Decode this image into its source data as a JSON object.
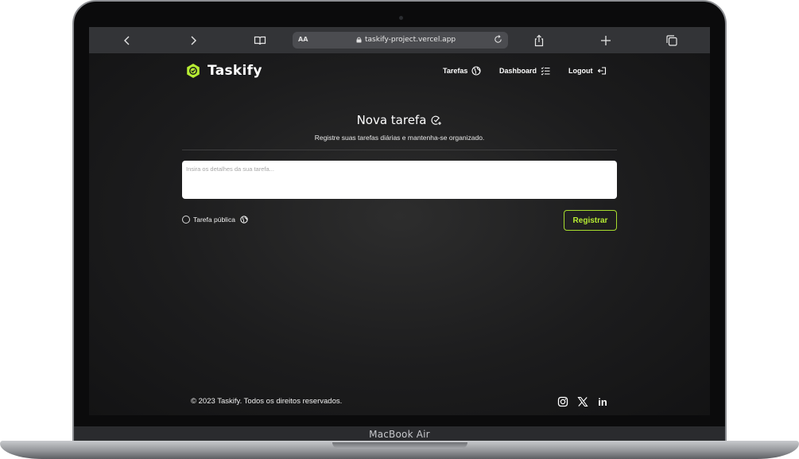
{
  "browser": {
    "aa_label": "AA",
    "url": "taskify-project.vercel.app"
  },
  "app": {
    "logo_text": "Taskify",
    "accent_color": "#b6ec33",
    "nav": [
      {
        "label": "Tarefas",
        "icon": "globe-icon"
      },
      {
        "label": "Dashboard",
        "icon": "checklist-icon"
      },
      {
        "label": "Logout",
        "icon": "logout-icon"
      }
    ]
  },
  "main": {
    "title": "Nova tarefa",
    "subtitle": "Registre suas tarefas diárias e mantenha-se organizado.",
    "input_placeholder": "Insira os detalhes da sua tarefa...",
    "public_label": "Tarefa pública",
    "public_checked": false,
    "submit_label": "Registrar"
  },
  "footer": {
    "copyright": "© 2023 Taskify. Todos os direitos reservados.",
    "social": [
      "instagram-icon",
      "x-icon",
      "linkedin-icon"
    ],
    "linkedin_label": "in"
  },
  "device": {
    "label": "MacBook Air"
  }
}
